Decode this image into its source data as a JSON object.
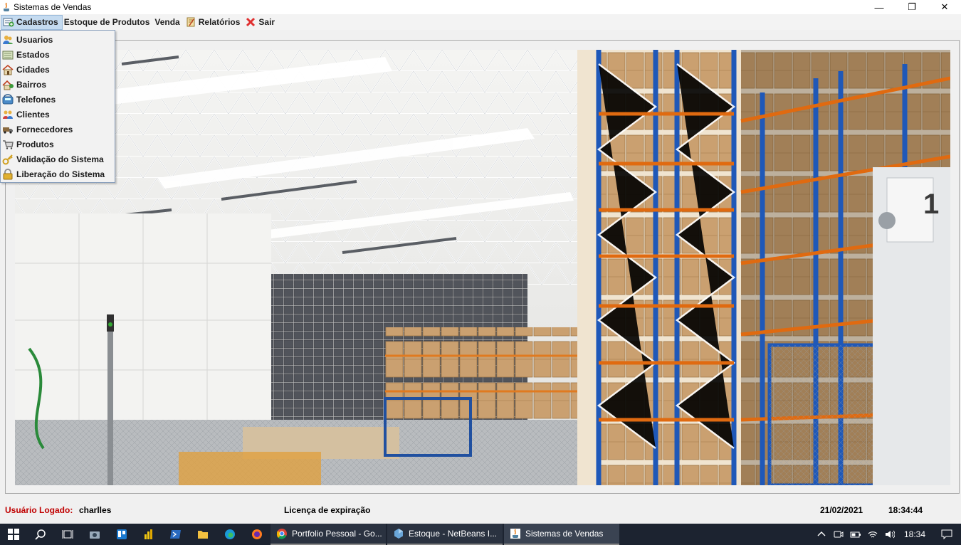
{
  "window": {
    "title": "Sistemas de Vendas",
    "controls": {
      "minimize": "—",
      "maximize": "❐",
      "close": "✕"
    }
  },
  "menubar": {
    "items": [
      {
        "label": "Cadastros",
        "icon": "form-add-icon",
        "active": true
      },
      {
        "label": "Estoque de Produtos"
      },
      {
        "label": "Venda"
      },
      {
        "label": "Relatórios",
        "icon": "report-icon"
      },
      {
        "label": "Sair",
        "icon": "close-icon"
      }
    ]
  },
  "dropdown": {
    "items": [
      {
        "label": "Usuarios",
        "icon": "users-icon"
      },
      {
        "label": "Estados",
        "icon": "map-icon"
      },
      {
        "label": "Cidades",
        "icon": "house-icon"
      },
      {
        "label": "Bairros",
        "icon": "house-tree-icon"
      },
      {
        "label": "Telefones",
        "icon": "phone-icon"
      },
      {
        "label": "Clientes",
        "icon": "clients-icon"
      },
      {
        "label": "Fornecedores",
        "icon": "truck-icon"
      },
      {
        "label": "Produtos",
        "icon": "cart-icon"
      },
      {
        "label": "Validação do Sistema",
        "icon": "key-icon"
      },
      {
        "label": "Liberação do Sistema",
        "icon": "lock-icon"
      }
    ]
  },
  "status": {
    "user_label": "Usuário Logado:",
    "user_value": "charlles",
    "license_label": "Licença de expiração",
    "date": "21/02/2021",
    "time": "18:34:44"
  },
  "taskbar": {
    "apps": [
      {
        "label": "Portfolio Pessoal - Go...",
        "icon": "chrome-icon"
      },
      {
        "label": "Estoque - NetBeans I...",
        "icon": "netbeans-icon"
      },
      {
        "label": "Sistemas de Vendas",
        "icon": "java-icon",
        "active": true
      }
    ],
    "clock": "18:34"
  },
  "colors": {
    "accent_red": "#c00000",
    "menu_highlight": "#c5dbf0",
    "taskbar": "#1c2330"
  }
}
